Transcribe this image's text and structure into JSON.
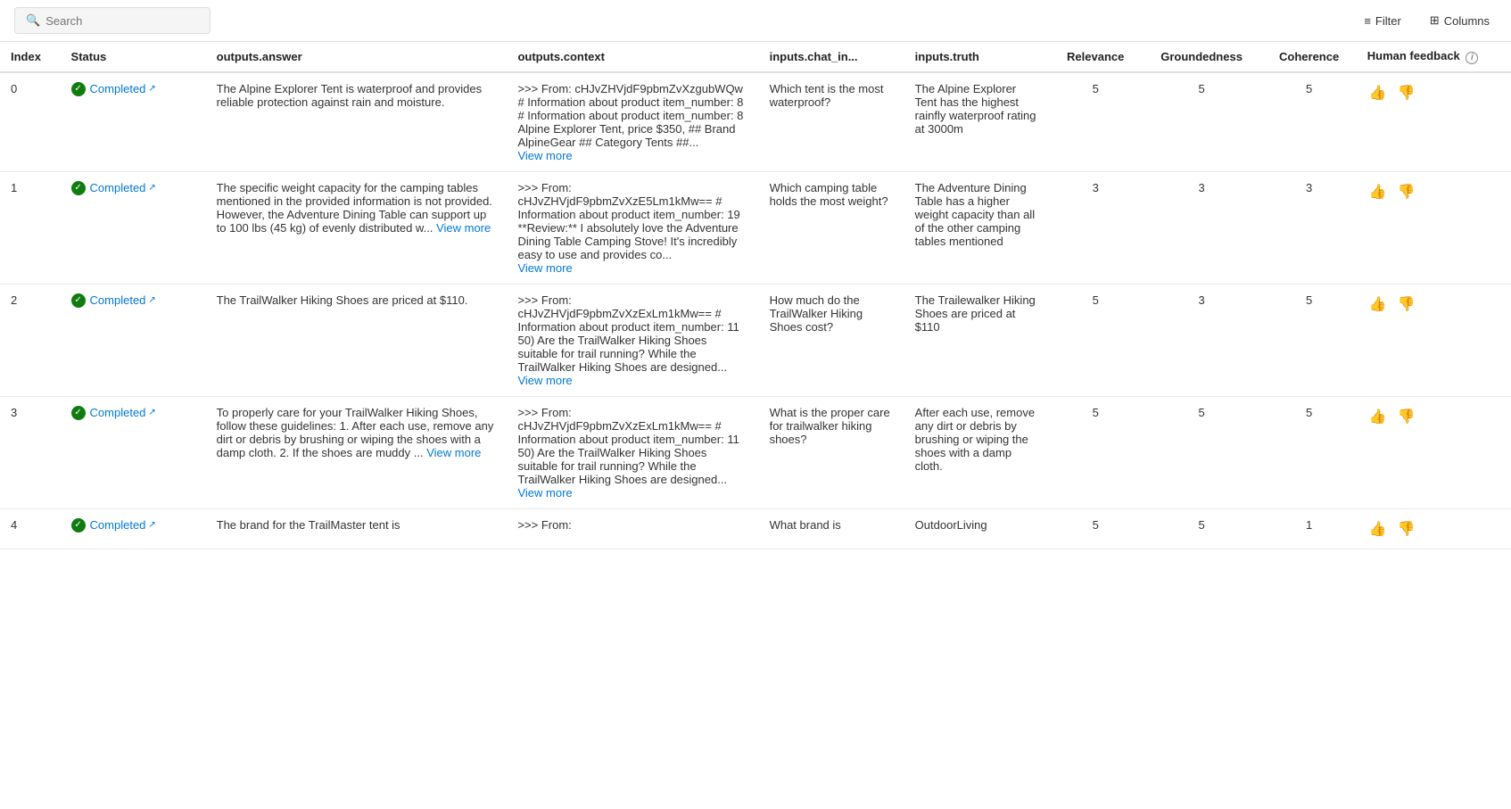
{
  "toolbar": {
    "search_placeholder": "Search",
    "filter_label": "Filter",
    "columns_label": "Columns"
  },
  "columns": {
    "index": "Index",
    "status": "Status",
    "outputs_answer": "outputs.answer",
    "outputs_context": "outputs.context",
    "inputs_chat_in": "inputs.chat_in...",
    "inputs_truth": "inputs.truth",
    "relevance": "Relevance",
    "groundedness": "Groundedness",
    "coherence": "Coherence",
    "human_feedback": "Human feedback"
  },
  "rows": [
    {
      "index": "0",
      "status": "Completed",
      "answer": "The Alpine Explorer Tent is waterproof and provides reliable protection against rain and moisture.",
      "context_short": ">>> From: cHJvZHVjdF9pbmZvXzgubWQw # Information about product item_number: 8 # Information about product item_number: 8 Alpine Explorer Tent, price $350, ## Brand AlpineGear ## Category Tents ##...",
      "context_has_more": true,
      "chat_in": "Which tent is the most waterproof?",
      "truth": "The Alpine Explorer Tent has the highest rainfly waterproof rating at 3000m",
      "relevance": "5",
      "groundedness": "5",
      "coherence": "5"
    },
    {
      "index": "1",
      "status": "Completed",
      "answer": "The specific weight capacity for the camping tables mentioned in the provided information is not provided. However, the Adventure Dining Table can support up to 100 lbs (45 kg) of evenly distributed w...",
      "answer_has_more": true,
      "answer_more_text": "View more",
      "context_short": ">>> From: cHJvZHVjdF9pbmZvXzE5Lm1kMw== # Information about product item_number: 19 **Review:** I absolutely love the Adventure Dining Table Camping Stove! It's incredibly easy to use and provides co...",
      "context_has_more": true,
      "chat_in": "Which camping table holds the most weight?",
      "truth": "The Adventure Dining Table has a higher weight capacity than all of the other camping tables mentioned",
      "relevance": "3",
      "groundedness": "3",
      "coherence": "3"
    },
    {
      "index": "2",
      "status": "Completed",
      "answer": "The TrailWalker Hiking Shoes are priced at $110.",
      "context_short": ">>> From: cHJvZHVjdF9pbmZvXzExLm1kMw== # Information about product item_number: 11 50) Are the TrailWalker Hiking Shoes suitable for trail running? While the TrailWalker Hiking Shoes are designed...",
      "context_has_more": true,
      "chat_in": "How much do the TrailWalker Hiking Shoes cost?",
      "truth": "The Trailewalker Hiking Shoes are priced at $110",
      "relevance": "5",
      "groundedness": "3",
      "coherence": "5"
    },
    {
      "index": "3",
      "status": "Completed",
      "answer": "To properly care for your TrailWalker Hiking Shoes, follow these guidelines: 1. After each use, remove any dirt or debris by brushing or wiping the shoes with a damp cloth. 2. If the shoes are muddy ...",
      "answer_has_more": true,
      "answer_more_text": "View more",
      "context_short": ">>> From: cHJvZHVjdF9pbmZvXzExLm1kMw== # Information about product item_number: 11 50) Are the TrailWalker Hiking Shoes suitable for trail running? While the TrailWalker Hiking Shoes are designed...",
      "context_has_more": true,
      "chat_in": "What is the proper care for trailwalker hiking shoes?",
      "truth": "After each use, remove any dirt or debris by brushing or wiping the shoes with a damp cloth.",
      "relevance": "5",
      "groundedness": "5",
      "coherence": "5"
    },
    {
      "index": "4",
      "status": "Completed",
      "answer": "The brand for the TrailMaster tent is",
      "context_short": ">>> From:",
      "context_has_more": false,
      "chat_in": "What brand is",
      "truth": "OutdoorLiving",
      "relevance": "5",
      "groundedness": "5",
      "coherence": "1"
    }
  ]
}
